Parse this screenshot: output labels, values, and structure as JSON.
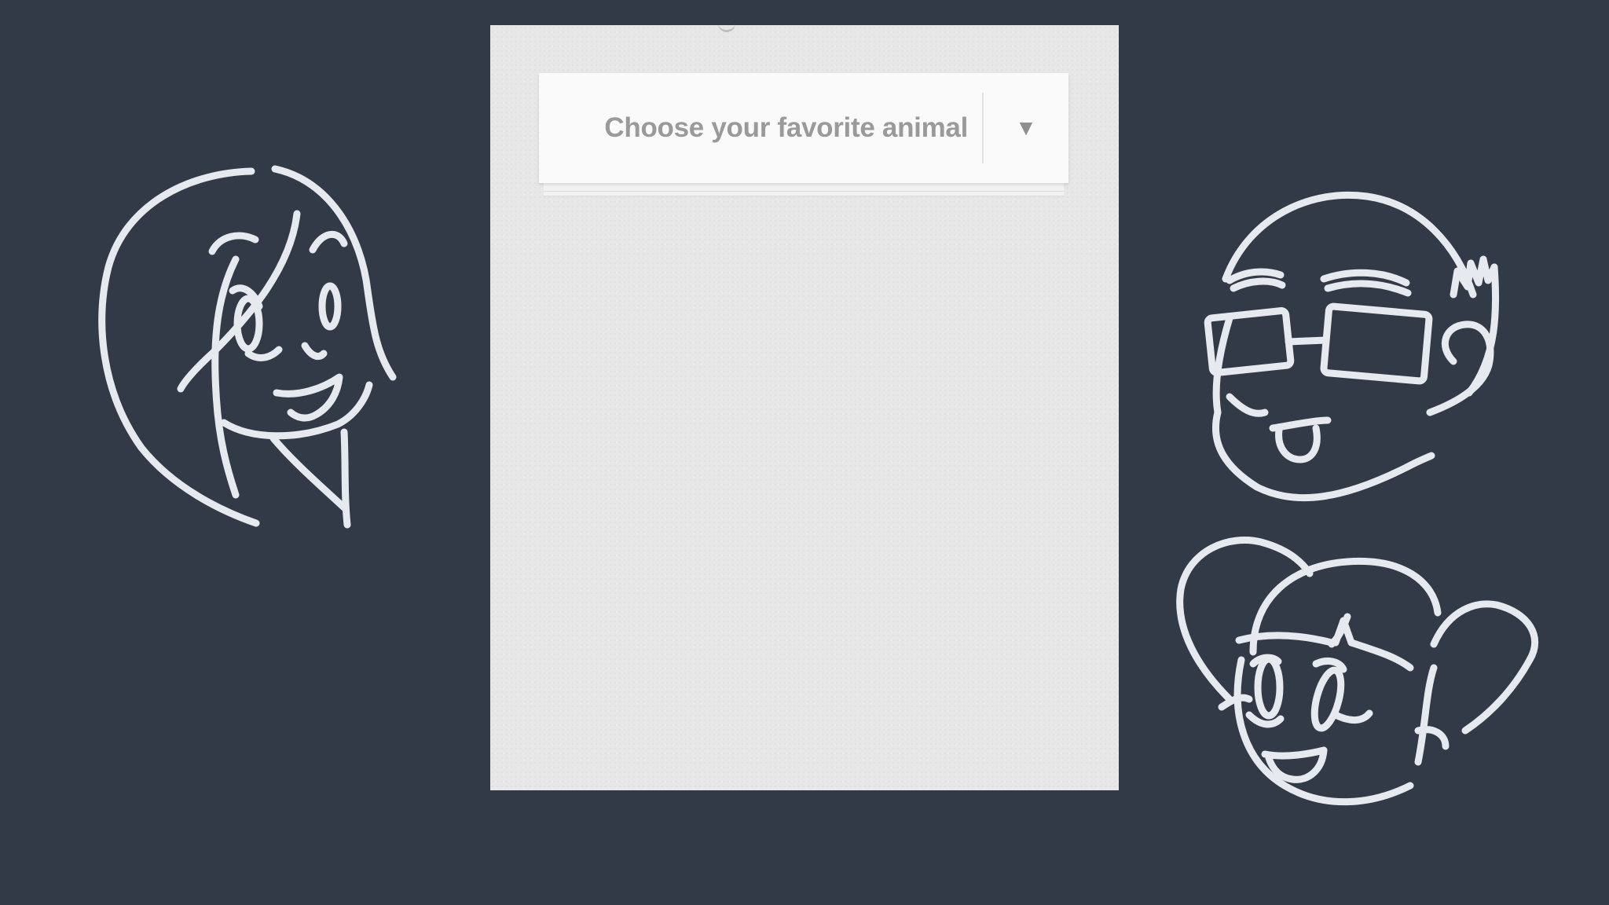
{
  "dropdown": {
    "selected_label": "Choose your favorite animal",
    "arrow_glyph": "▼"
  },
  "colors": {
    "background": "#333a47",
    "panel": "#e7e7e7",
    "dropdown_text": "#9a9a9a",
    "doodle_stroke": "#e6e9ee"
  },
  "doodles": [
    {
      "icon": "girl-face-doodle-icon"
    },
    {
      "icon": "boy-with-glasses-doodle-icon"
    },
    {
      "icon": "girl-with-pigtails-doodle-icon"
    }
  ]
}
